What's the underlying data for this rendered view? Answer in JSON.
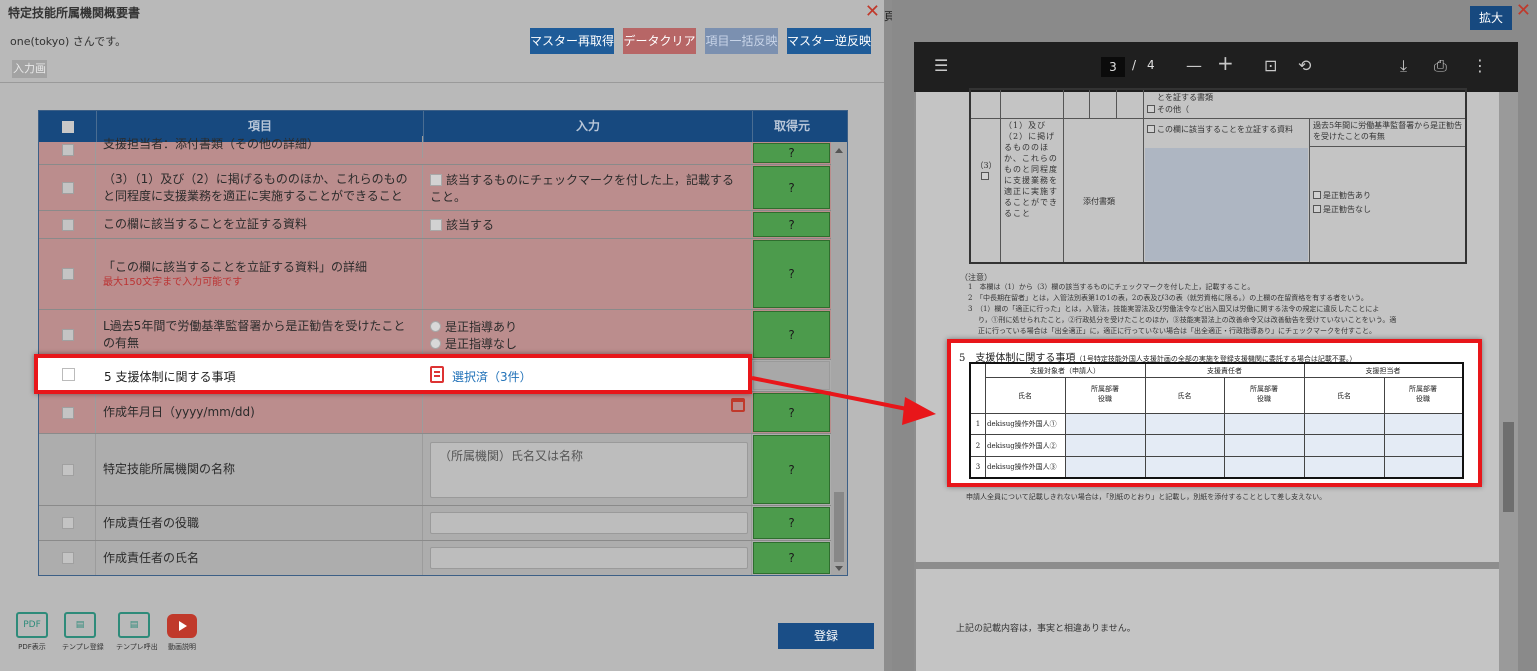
{
  "left_dialog": {
    "title": "特定技能所属機関概要書",
    "user_line": "one(tokyo) さんです。",
    "buttons": {
      "master_refetch": "マスター再取得",
      "data_clear": "データクリア",
      "item_reflect": "項目一括反映",
      "master_reverse": "マスター逆反映"
    },
    "input_tab": "入力画",
    "grid": {
      "headers": [
        "項目",
        "入力",
        "取得元"
      ],
      "rows": [
        {
          "item": "支援担当者：添付書類（その他の詳細）",
          "src": "?"
        },
        {
          "item": "（3）（1）及び（2）に掲げるもののほか、これらのものと同程度に支援業務を適正に実施することができること",
          "input": "該当するものにチェックマークを付した上，記載すること。",
          "src": "?"
        },
        {
          "item": "この欄に該当することを立証する資料",
          "input": "該当する",
          "src": "?"
        },
        {
          "item": "「この欄に該当することを立証する資料」の詳細",
          "hint": "最大150文字まで入力可能です",
          "src": "?"
        },
        {
          "item": "L過去5年間で労働基準監督署から是正勧告を受けたことの有無",
          "input_options": [
            "是正指導あり",
            "是正指導なし"
          ],
          "src": "?"
        },
        {
          "item": "5 支援体制に関する事項",
          "input": "選択済（3件）",
          "src": ""
        },
        {
          "item": "作成年月日（yyyy/mm/dd)",
          "src": "?"
        },
        {
          "item": "特定技能所属機関の名称",
          "placeholder": "（所属機関）氏名又は名称",
          "src": "?"
        },
        {
          "item": "作成責任者の役職",
          "src": "?"
        },
        {
          "item": "作成責任者の氏名",
          "src": "?"
        }
      ]
    },
    "bottom_icons": [
      {
        "box": "PDF",
        "label": "PDF表示"
      },
      {
        "box": "",
        "label": "テンプレ登録"
      },
      {
        "box": "",
        "label": "テンプレ呼出"
      },
      {
        "box": "",
        "label": "動画説明"
      }
    ],
    "register": "登録"
  },
  "middle_label": "頁",
  "pdf_viewer": {
    "expand_button": "拡大",
    "page_current": "3",
    "page_separator": "/",
    "page_total": "4",
    "page": {
      "top_small": "とを証する書類",
      "top_other": "その他（",
      "row3_label": "（3）",
      "row3_text": "（1）及び（2）に掲げるもののほか、これらのものと同程度に支援業務を適正に実施することができること",
      "attach": "添付書類",
      "proof_text": "この欄に該当することを立証する資料",
      "past5": "過去5年間に労働基準監督署から是正勧告を受けたことの有無",
      "opt1": "是正勧告あり",
      "opt2": "是正勧告なし",
      "notes_head": "（注意）",
      "notes": [
        "1　本欄は（1）から（3）欄の該当するものにチェックマークを付した上，記載すること。",
        "2　「中長期在留者」とは，入管法別表第1の1の表，2の表及び3の表（就労資格に限る。）の上欄の在留資格を有する者をいう。",
        "3　（1）欄の「適正に行った」とは，入管法，技能実習法及び労働法令など出入国又は労働に関する法令の規定に違反したことによ",
        "り，①刑に処せられたこと，②行政処分を受けたことのほか，③技能実習法上の改善命令又は改善勧告を受けていないことをいう。適",
        "正に行っている場合は「出全適正」に，適正に行っていない場合は「出全適正・行政指導あり」にチェックマークを付すこと。"
      ],
      "footer_note": "申請人全員について記載しきれない場合は，「別紙のとおり」と記載し，別紙を添付することとして差し支えない。",
      "page2_text": "上記の記載内容は，事実と相違ありません。"
    },
    "section5": {
      "title": "5　支援体制に関する事項",
      "title_note": "（1号特定技能外国人支援計画の全部の実施を登録支援機関に委託する場合は記載不要。）",
      "groups": [
        "支援対象者（申請人）",
        "支援責任者",
        "支援担当者"
      ],
      "sub_headers": [
        "氏名",
        "所属部署\n役職",
        "氏名",
        "所属部署\n役職",
        "氏名",
        "所属部署\n役職"
      ],
      "rows": [
        {
          "no": "1",
          "name": "dekisug操作外国人①"
        },
        {
          "no": "2",
          "name": "dekisug操作外国人②"
        },
        {
          "no": "3",
          "name": "dekisug操作外国人③"
        }
      ]
    }
  },
  "icons": [
    "menu-icon",
    "minus-icon",
    "plus-icon",
    "fit-page-icon",
    "rotate-icon",
    "download-icon",
    "print-icon",
    "more-icon",
    "calendar-icon",
    "list-icon",
    "youtube-icon"
  ],
  "colors": {
    "highlight": "#e8161a",
    "header_blue": "#17497f",
    "source_green": "#4c9b4c",
    "link_blue": "#2071b8"
  }
}
